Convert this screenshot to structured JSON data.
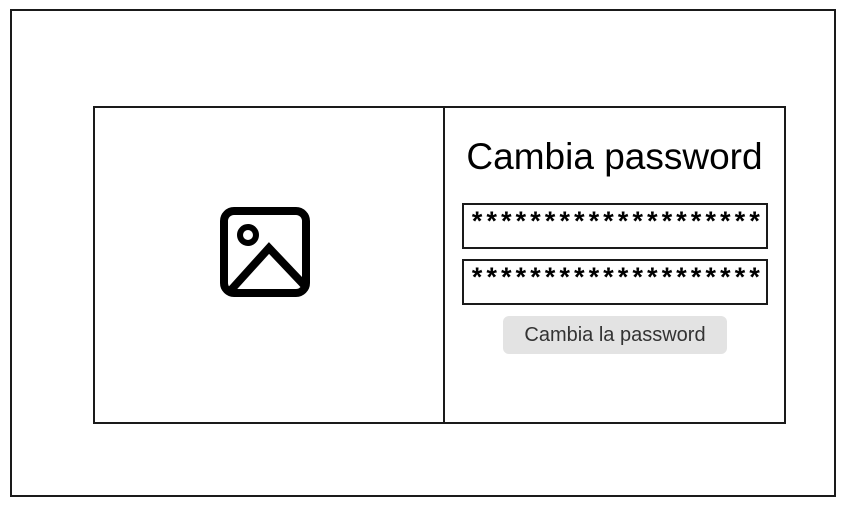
{
  "form": {
    "title": "Cambia password",
    "password_field_1": "********************",
    "password_field_2": "********************",
    "submit_label": "Cambia la password"
  },
  "image_placeholder": {
    "icon": "image-icon"
  },
  "colors": {
    "border": "#1a1a1a",
    "button_bg": "#e3e3e3",
    "button_text": "#333333"
  }
}
